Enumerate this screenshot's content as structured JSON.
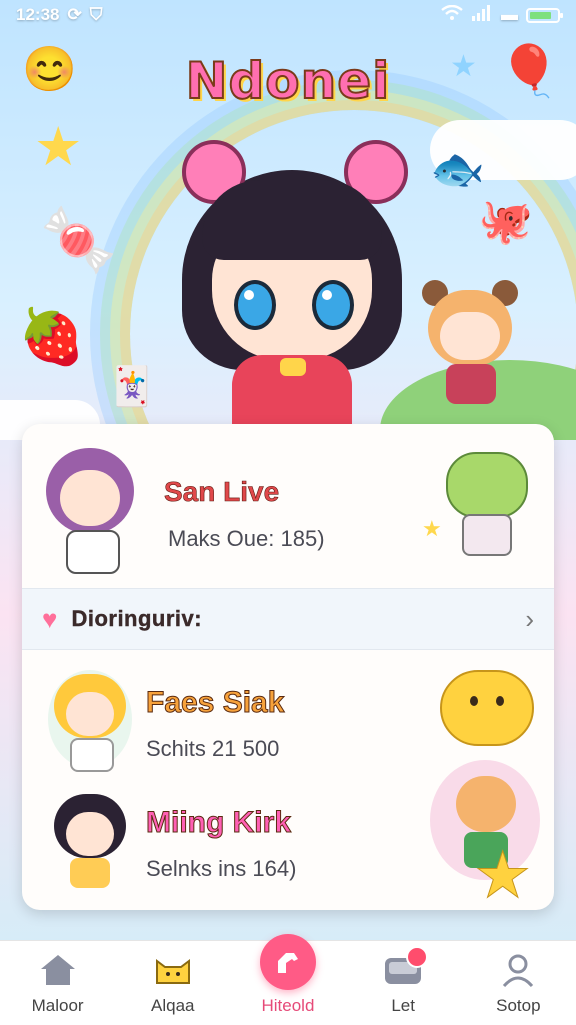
{
  "status_bar": {
    "time": "12:38",
    "icons": [
      "sync-icon",
      "shield-icon",
      "wifi-icon",
      "signal-icon",
      "battery-icon"
    ]
  },
  "app": {
    "title": "Ndonei"
  },
  "featured": {
    "name": "San Live",
    "subtitle": "Maks Oue: 185)"
  },
  "section": {
    "title": "Dioringuriv:"
  },
  "items": [
    {
      "name": "Faes Siak",
      "subtitle": "Schits 21 500",
      "name_color": "#f7a23b"
    },
    {
      "name": "Miing Kirk",
      "subtitle": "Selnks ins 164)",
      "name_color": "#ff5fb4"
    }
  ],
  "nav": [
    {
      "label": "Maloor",
      "icon": "home-icon"
    },
    {
      "label": "Alqaa",
      "icon": "cat-icon"
    },
    {
      "label": "Hiteold",
      "icon": "horse-icon",
      "active": true
    },
    {
      "label": "Let",
      "icon": "inbox-icon",
      "badge": true
    },
    {
      "label": "Sotop",
      "icon": "user-icon"
    }
  ],
  "colors": {
    "accent": "#ff5b86",
    "featured_name": "#e0484a",
    "featured_name_alt": "#3d6fd8"
  }
}
